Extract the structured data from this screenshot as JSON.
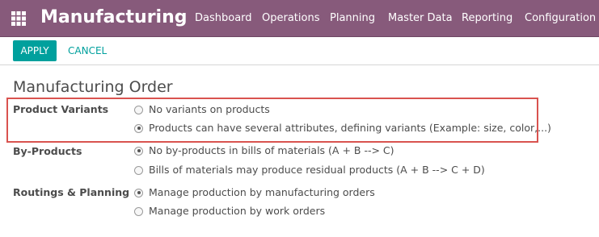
{
  "app": {
    "title": "Manufacturing"
  },
  "menu": [
    "Dashboard",
    "Operations",
    "Planning",
    "Master Data",
    "Reporting",
    "Configuration"
  ],
  "toolbar": {
    "apply_label": "APPLY",
    "cancel_label": "CANCEL"
  },
  "section": {
    "title": "Manufacturing Order"
  },
  "settings": [
    {
      "label": "Product Variants",
      "options": [
        {
          "text": "No variants on products",
          "checked": false
        },
        {
          "text": "Products can have several attributes, defining variants (Example: size, color,...)",
          "checked": true
        }
      ]
    },
    {
      "label": "By-Products",
      "options": [
        {
          "text": "No by-products in bills of materials (A + B --> C)",
          "checked": true
        },
        {
          "text": "Bills of materials may produce residual products (A + B --> C + D)",
          "checked": false
        }
      ]
    },
    {
      "label": "Routings & Planning",
      "options": [
        {
          "text": "Manage production by manufacturing orders",
          "checked": true
        },
        {
          "text": "Manage production by work orders",
          "checked": false
        }
      ]
    }
  ],
  "colors": {
    "navbar": "#875a7b",
    "accent": "#00a09d",
    "highlight": "#d9534f"
  }
}
